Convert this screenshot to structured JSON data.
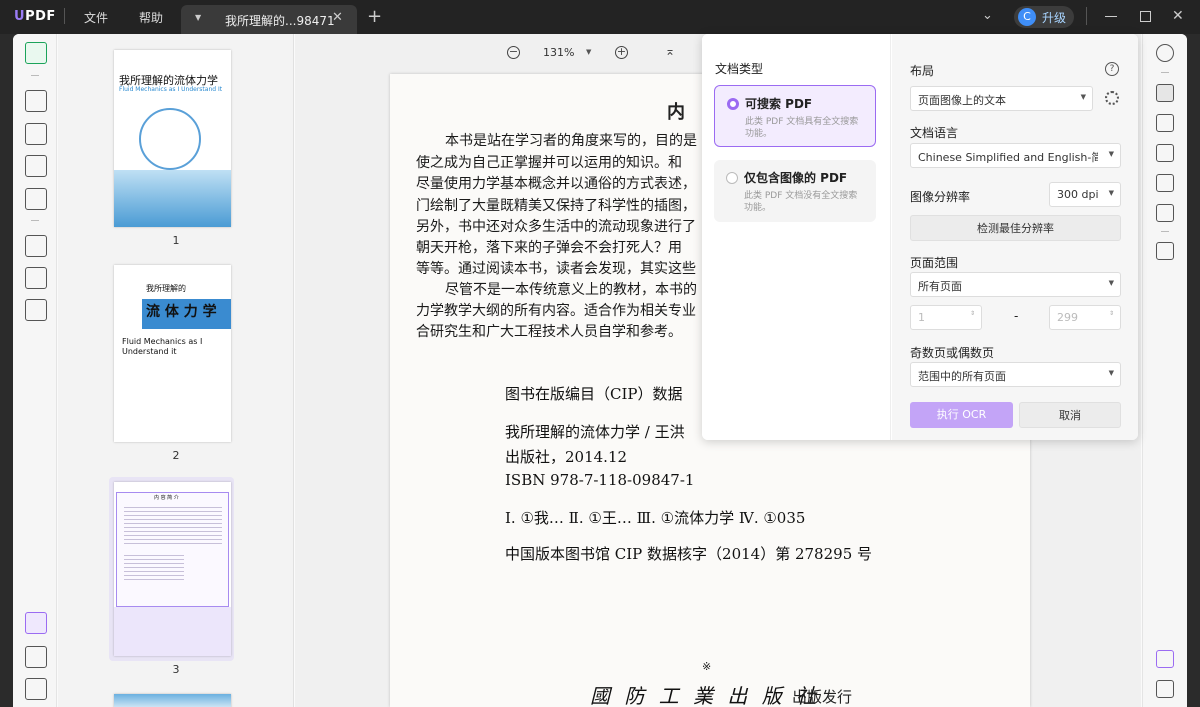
{
  "titlebar": {
    "logo": "UPDF",
    "menu_file": "文件",
    "menu_help": "帮助",
    "tab_title": "我所理解的...98471",
    "upgrade_avatar": "C",
    "upgrade_label": "升级"
  },
  "toolbar": {
    "zoom": "131%"
  },
  "thumbnails": [
    {
      "num": "1",
      "title": "我所理解的流体力学",
      "subtitle": "Fluid Mechanics as I Understand It"
    },
    {
      "num": "2",
      "title": "流 体 力 学",
      "pre": "我所理解的",
      "subtitle": "Fluid Mechanics as I Understand it"
    },
    {
      "num": "3",
      "title": "内 容 简 介"
    }
  ],
  "document": {
    "heading": "内",
    "lines": [
      "本书是站在学习者的角度来写的，目的是",
      "使之成为自己正掌握并可以运用的知识。和",
      "尽量使用力学基本概念并以通俗的方式表述，",
      "门绘制了大量既精美又保持了科学性的插图，",
      "另外，书中还对众多生活中的流动现象进行了",
      "朝天开枪，落下来的子弹会不会打死人？用",
      "等等。通过阅读本书，读者会发现，其实这些",
      "尽管不是一本传统意义上的教材，本书的",
      "力学教学大纲的所有内容。适合作为相关专业",
      "合研究生和广大工程技术人员自学和参考。"
    ],
    "cip_title": "图书在版编目（CIP）数据",
    "cip_line1": "我所理解的流体力学 / 王洪",
    "cip_line2": "出版社，2014.12",
    "cip_isbn": "ISBN 978-7-118-09847-1",
    "cip_class": "Ⅰ. ①我… Ⅱ. ①王… Ⅲ. ①流体力学 Ⅳ. ①035",
    "cip_number": "中国版本图书馆 CIP 数据核字（2014）第 278295 号",
    "mark": "※",
    "publisher": "出版发行"
  },
  "ocr": {
    "doc_type_label": "文档类型",
    "option1_title": "可搜索 PDF",
    "option1_desc": "此类 PDF 文档具有全文搜索功能。",
    "option2_title": "仅包含图像的 PDF",
    "option2_desc": "此类 PDF 文档没有全文搜索功能。",
    "layout_label": "布局",
    "layout_value": "页面图像上的文本",
    "lang_label": "文档语言",
    "lang_value": "Chinese Simplified and English-简体...",
    "res_label": "图像分辨率",
    "res_value": "300 dpi",
    "detect_button": "检测最佳分辨率",
    "range_label": "页面范围",
    "range_value": "所有页面",
    "range_from": "1",
    "range_dash": "-",
    "range_to": "299",
    "oddeven_label": "奇数页或偶数页",
    "oddeven_value": "范围中的所有页面",
    "run_button": "执行 OCR",
    "cancel_button": "取消",
    "help_glyph": "?"
  },
  "colors": {
    "accent": "#9b6bf2",
    "run_button": "#c3a4f7",
    "option_selected_bg": "#f3ecfe"
  }
}
